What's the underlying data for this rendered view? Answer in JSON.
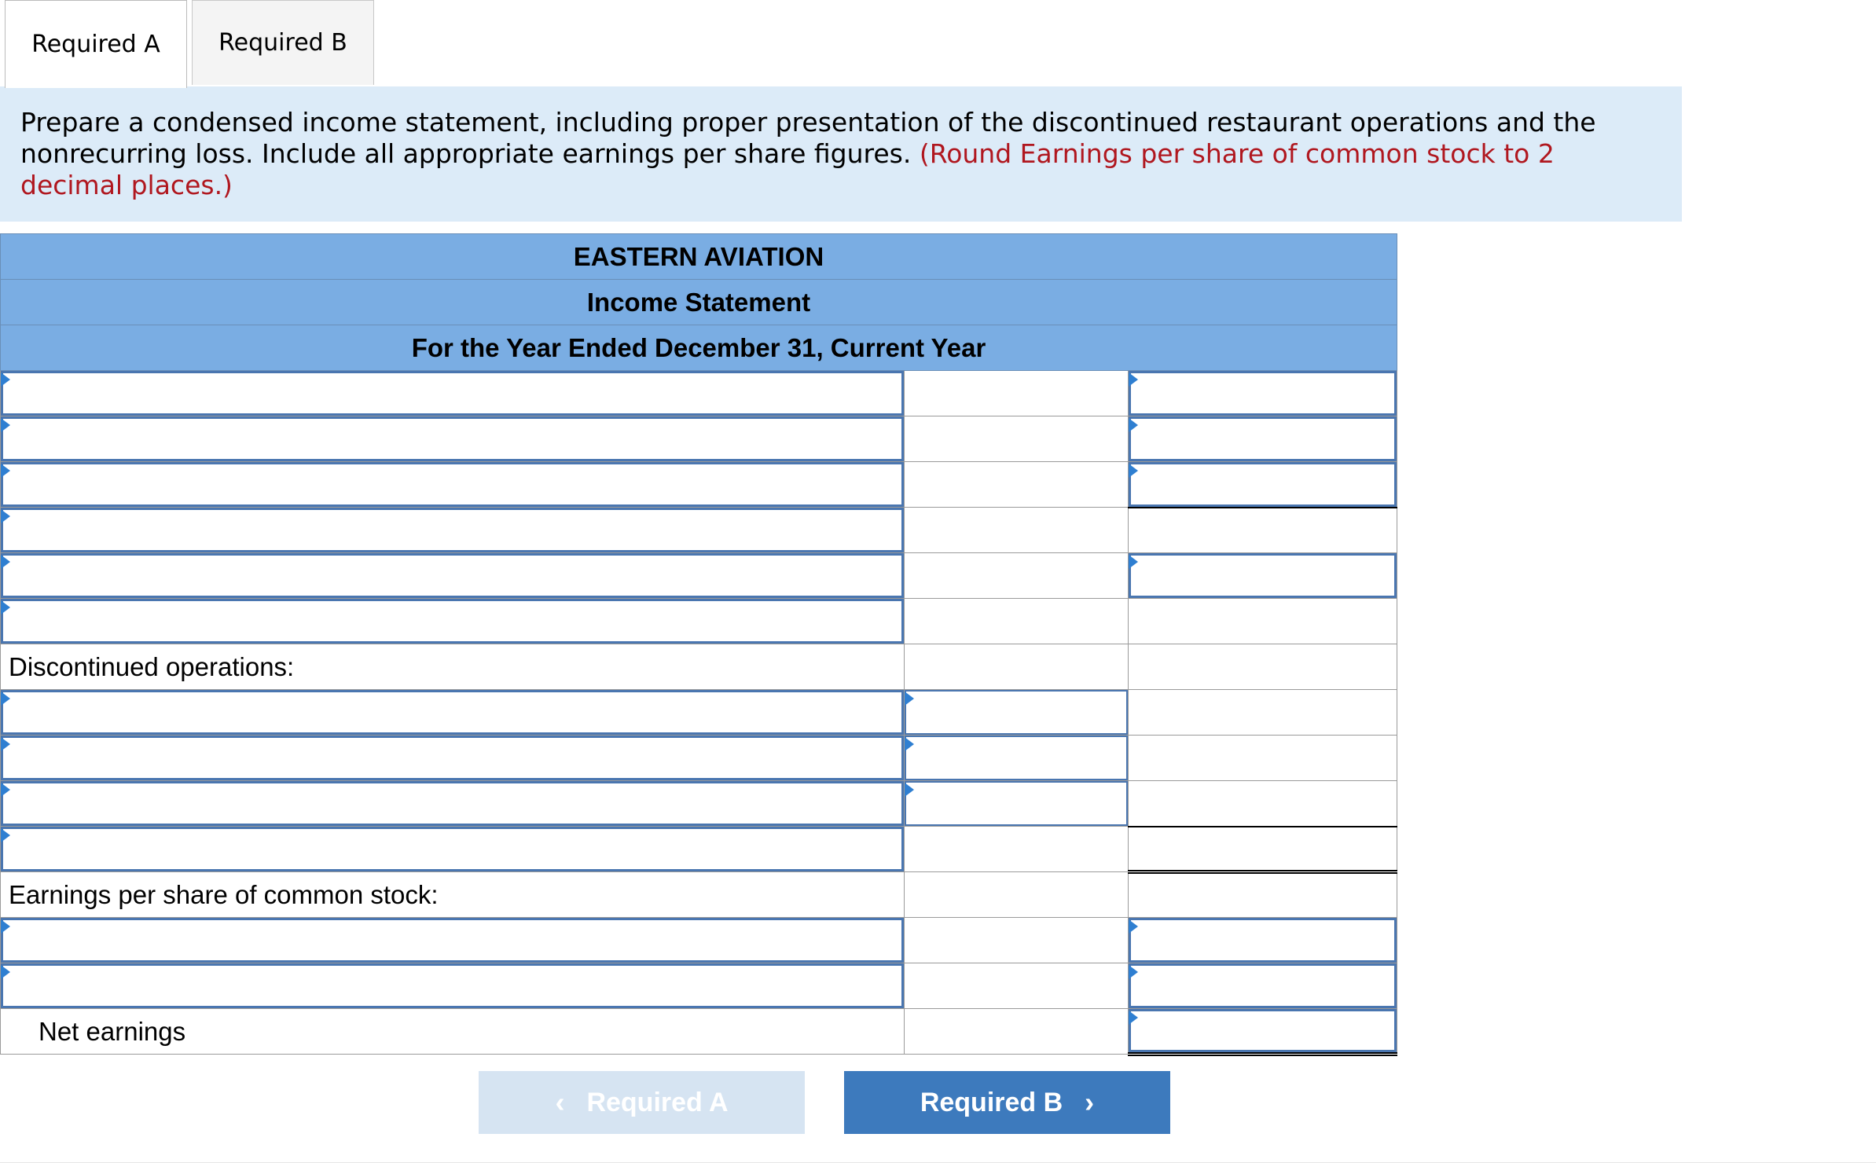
{
  "tabs": [
    {
      "label": "Required A",
      "active": true
    },
    {
      "label": "Required B",
      "active": false
    }
  ],
  "instructions": {
    "text": "Prepare a condensed income statement, including proper presentation of the discontinued restaurant operations and the nonrecurring loss. Include all appropriate earnings per share figures.",
    "note": "(Round Earnings per share of common stock to 2 decimal places.)"
  },
  "statement": {
    "company": "EASTERN AVIATION",
    "title": "Income Statement",
    "period": "For the Year Ended December 31, Current Year",
    "labels": {
      "discontinued": "Discontinued operations:",
      "eps": "Earnings per share of common stock:",
      "net_earnings": "Net earnings"
    }
  },
  "navigation": {
    "prev_label": "Required A",
    "next_label": "Required B",
    "prev_icon": "chevron-left-icon",
    "next_icon": "chevron-right-icon"
  },
  "colors": {
    "header_blue": "#7aade3",
    "instruction_bg": "#dcebf8",
    "note_red": "#b0171f",
    "button_blue": "#3d7abd",
    "input_border": "#4a76b0"
  }
}
